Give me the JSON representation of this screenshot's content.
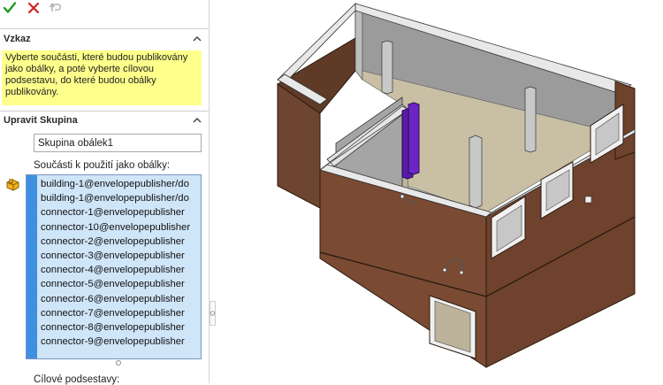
{
  "toolbar": {
    "ok_icon": "check-icon",
    "cancel_icon": "close-icon",
    "undo_icon": "undo-icon"
  },
  "message_section": {
    "title": "Vzkaz",
    "text": "Vyberte součásti, které budou publikovány jako obálky, a poté vyberte cílovou podsestavu, do které budou obálky publikovány."
  },
  "edit_group": {
    "title": "Upravit Skupina",
    "group_name": "Skupina obálek1",
    "components_label": "Součásti k použití jako obálky:",
    "components": [
      "building-1@envelopepublisher/do",
      "building-1@envelopepublisher/do",
      "connector-1@envelopepublisher",
      "connector-10@envelopepublisher",
      "connector-2@envelopepublisher",
      "connector-3@envelopepublisher",
      "connector-4@envelopepublisher",
      "connector-5@envelopepublisher",
      "connector-6@envelopepublisher",
      "connector-7@envelopepublisher",
      "connector-8@envelopepublisher",
      "connector-9@envelopepublisher"
    ],
    "target_label": "Cílové podsestavy:"
  },
  "colors": {
    "message_bg": "#ffff8c",
    "list_bg": "#cfe5f8",
    "list_strip": "#3f8fe0",
    "wall_brick": "#7a4a32",
    "wall_top": "#e0e0e0",
    "column": "#c8c8c8",
    "column_selected": "#5a1aa8"
  }
}
